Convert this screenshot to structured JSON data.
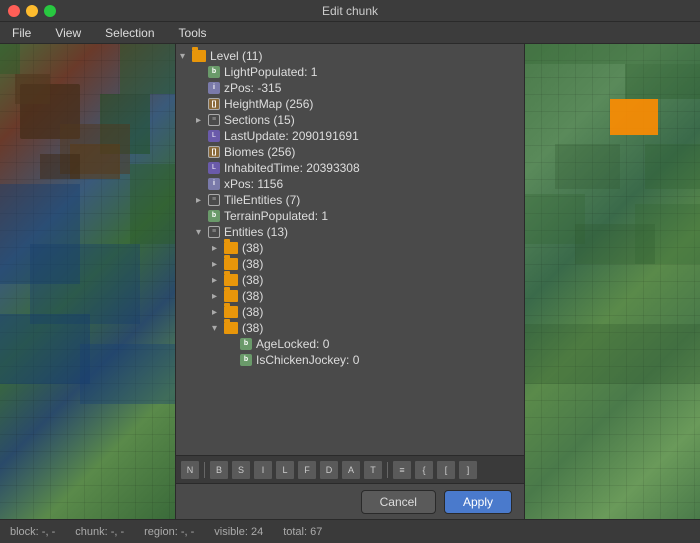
{
  "window": {
    "title": "Edit chunk"
  },
  "titlebar": {
    "close": "×",
    "minimize": "−",
    "maximize": "+"
  },
  "menubar": {
    "items": [
      "File",
      "View",
      "Selection",
      "Tools"
    ]
  },
  "tree": {
    "items": [
      {
        "id": "level",
        "indent": 0,
        "type": "folder",
        "expand": "open",
        "label": "Level (11)"
      },
      {
        "id": "lightpop",
        "indent": 1,
        "type": "byte",
        "expand": "none",
        "label": "LightPopulated: 1"
      },
      {
        "id": "zpos",
        "indent": 1,
        "type": "int",
        "expand": "none",
        "label": "zPos: -315"
      },
      {
        "id": "heightmap",
        "indent": 1,
        "type": "bytearray",
        "expand": "none",
        "label": "HeightMap (256)"
      },
      {
        "id": "sections",
        "indent": 1,
        "type": "list",
        "expand": "closed",
        "label": "Sections (15)"
      },
      {
        "id": "lastupdate",
        "indent": 1,
        "type": "long",
        "expand": "none",
        "label": "LastUpdate: 2090191691"
      },
      {
        "id": "biomes",
        "indent": 1,
        "type": "bytearray",
        "expand": "none",
        "label": "Biomes (256)"
      },
      {
        "id": "inhabitedtime",
        "indent": 1,
        "type": "long",
        "expand": "none",
        "label": "InhabitedTime: 20393308"
      },
      {
        "id": "xpos",
        "indent": 1,
        "type": "int",
        "expand": "none",
        "label": "xPos: 1156"
      },
      {
        "id": "tileentities",
        "indent": 1,
        "type": "list",
        "expand": "closed",
        "label": "TileEntities (7)"
      },
      {
        "id": "terrainpop",
        "indent": 1,
        "type": "byte",
        "expand": "none",
        "label": "TerrainPopulated: 1"
      },
      {
        "id": "entities",
        "indent": 1,
        "type": "list",
        "expand": "open",
        "label": "Entities (13)"
      },
      {
        "id": "ent1",
        "indent": 2,
        "type": "folder",
        "expand": "closed",
        "label": "(38)"
      },
      {
        "id": "ent2",
        "indent": 2,
        "type": "folder",
        "expand": "closed",
        "label": "(38)"
      },
      {
        "id": "ent3",
        "indent": 2,
        "type": "folder",
        "expand": "closed",
        "label": "(38)"
      },
      {
        "id": "ent4",
        "indent": 2,
        "type": "folder",
        "expand": "closed",
        "label": "(38)"
      },
      {
        "id": "ent5",
        "indent": 2,
        "type": "folder",
        "expand": "closed",
        "label": "(38)"
      },
      {
        "id": "ent6",
        "indent": 2,
        "type": "folder",
        "expand": "open",
        "label": "(38)"
      },
      {
        "id": "agelocked",
        "indent": 3,
        "type": "byte",
        "expand": "none",
        "label": "AgeLocked: 0"
      },
      {
        "id": "ischickenjockey",
        "indent": 3,
        "type": "byte",
        "expand": "none",
        "label": "IsChickenJockey: 0"
      }
    ]
  },
  "toolbar": {
    "buttons": [
      {
        "id": "btn-nbt",
        "label": "N"
      },
      {
        "id": "btn-byte",
        "label": "B"
      },
      {
        "id": "btn-short",
        "label": "S"
      },
      {
        "id": "btn-int",
        "label": "I"
      },
      {
        "id": "btn-long",
        "label": "L"
      },
      {
        "id": "btn-float",
        "label": "F"
      },
      {
        "id": "btn-double",
        "label": "D"
      },
      {
        "id": "btn-array",
        "label": "A"
      },
      {
        "id": "btn-string",
        "label": "T"
      },
      {
        "id": "btn-list",
        "label": "≡"
      },
      {
        "id": "btn-compound",
        "label": "{"
      },
      {
        "id": "btn-iarr",
        "label": "["
      },
      {
        "id": "btn-larr",
        "label": "]"
      }
    ]
  },
  "buttons": {
    "cancel": "Cancel",
    "apply": "Apply"
  },
  "statusbar": {
    "block": "block: -, -",
    "chunk": "chunk: -, -",
    "region": "region: -, -",
    "visible": "visible: 24",
    "total": "total: 67"
  }
}
